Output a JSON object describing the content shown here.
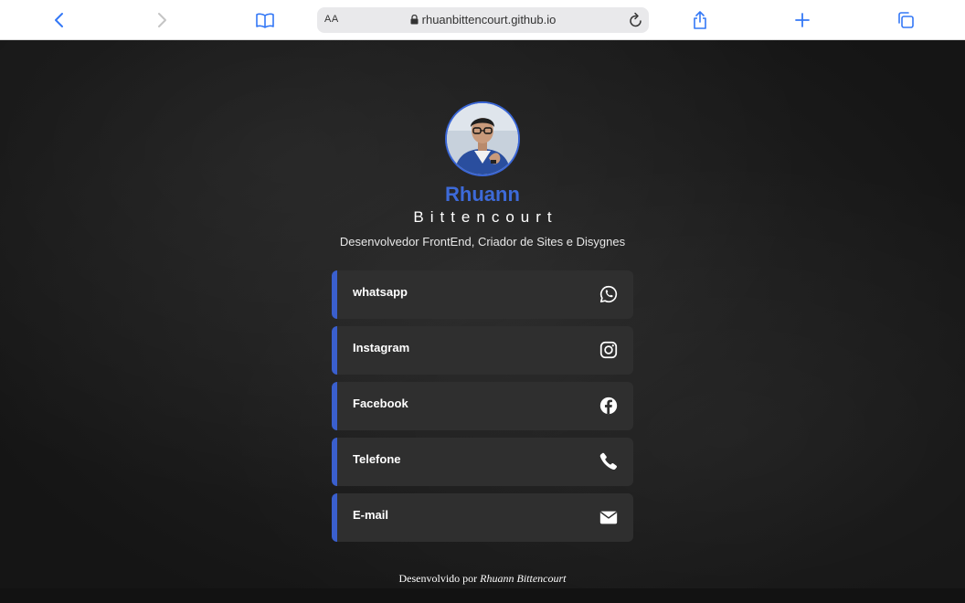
{
  "browser": {
    "aa_label": "AA",
    "url": "rhuanbittencourt.github.io"
  },
  "profile": {
    "first_name": "Rhuann",
    "last_name": "Bittencourt",
    "subtitle": "Desenvolvedor FrontEnd, Criador de Sites e Disygnes"
  },
  "links": [
    {
      "label": "whatsapp",
      "icon": "whatsapp-icon"
    },
    {
      "label": "Instagram",
      "icon": "instagram-icon"
    },
    {
      "label": "Facebook",
      "icon": "facebook-icon"
    },
    {
      "label": "Telefone",
      "icon": "phone-icon"
    },
    {
      "label": "E-mail",
      "icon": "email-icon"
    }
  ],
  "footer": {
    "prefix": "Desenvolvido por",
    "author": "Rhuann Bittencourt"
  },
  "colors": {
    "accent": "#3a5fcd",
    "name_blue": "#3d6ad8",
    "card_bg": "#2f2f2f",
    "toolbar_icon": "#3478f6"
  }
}
